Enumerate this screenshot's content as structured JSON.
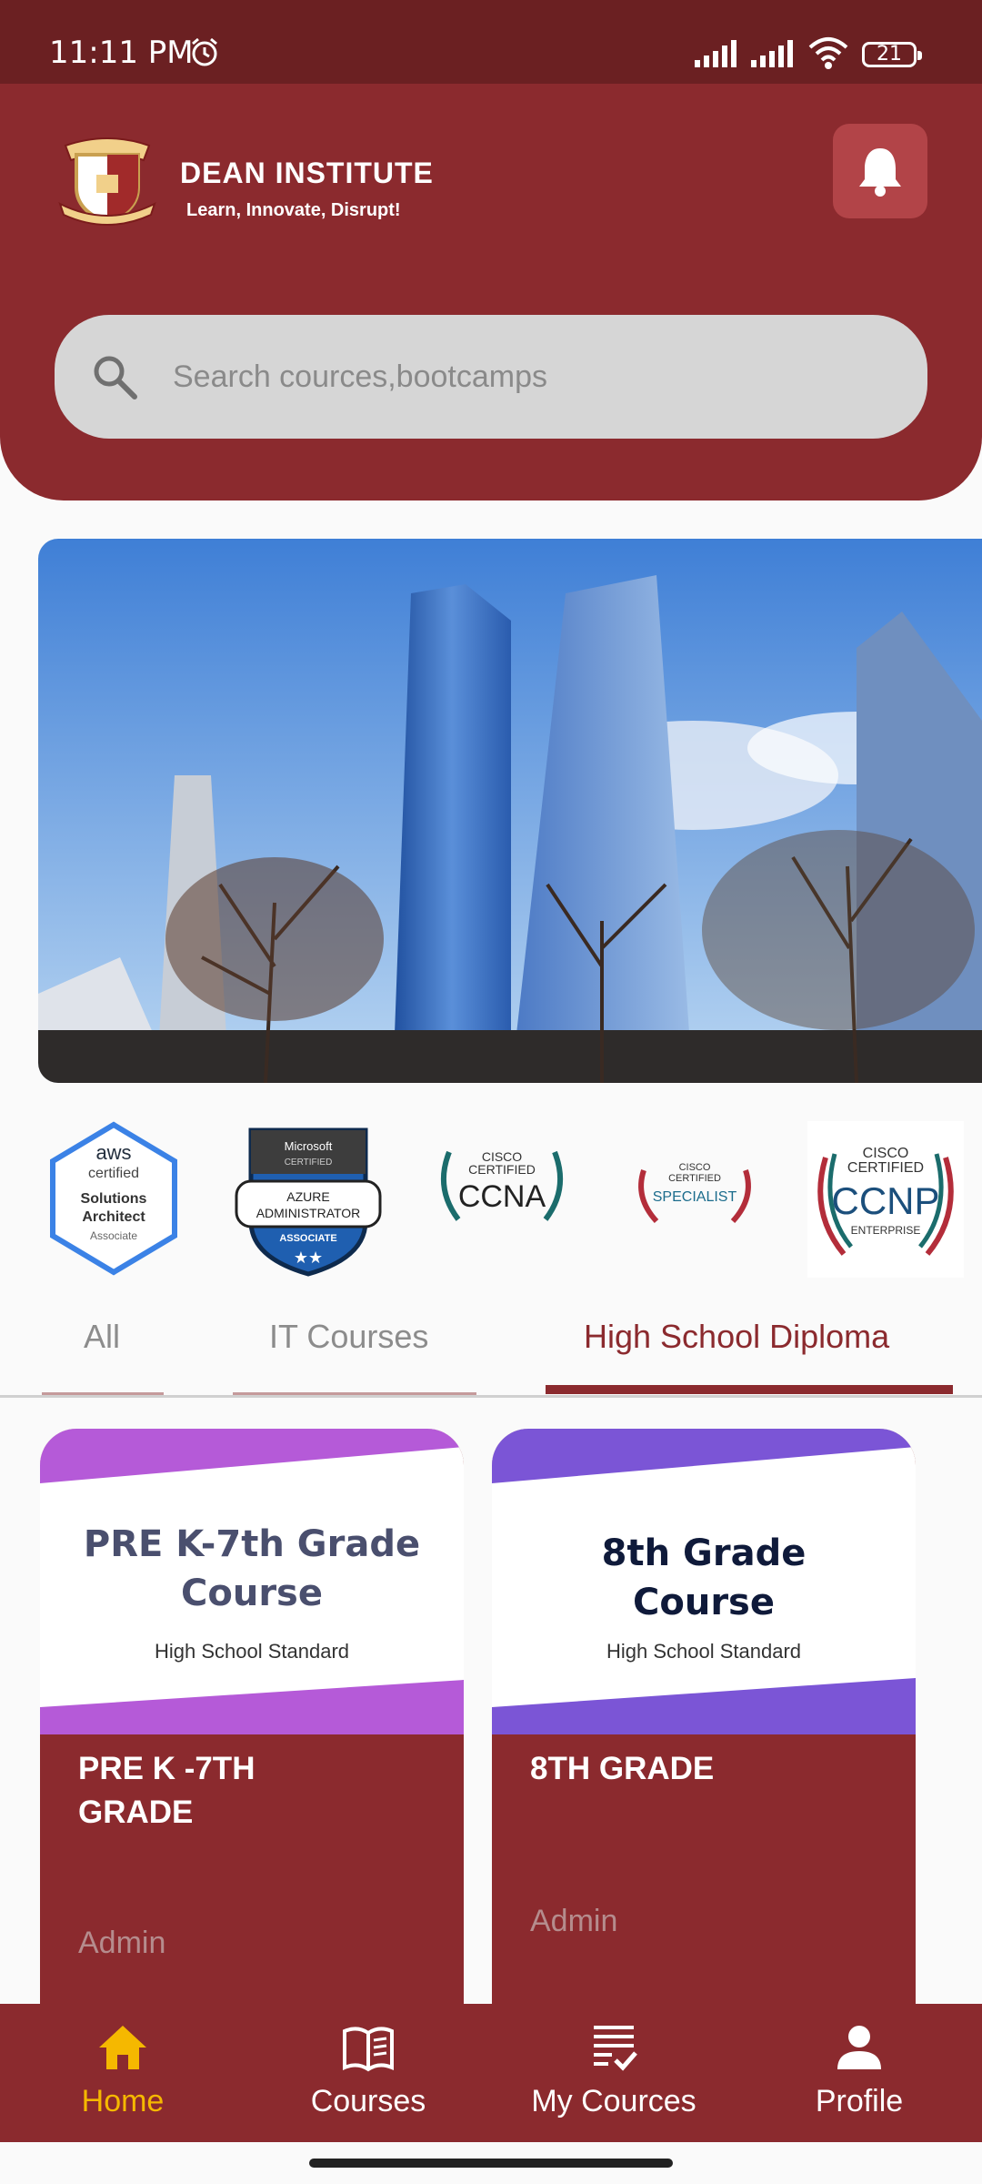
{
  "status": {
    "time": "11:11 PM",
    "battery": "21"
  },
  "header": {
    "brand_title": "DEAN INSTITUTE",
    "brand_subtitle": "Learn, Innovate, Disrupt!",
    "logo_text": "DEAN INSTITUTE"
  },
  "search": {
    "placeholder": "Search cources,bootcamps"
  },
  "certifications": [
    {
      "name": "aws",
      "line1": "aws",
      "line2": "certified",
      "line3": "Solutions",
      "line4": "Architect",
      "line5": "Associate"
    },
    {
      "name": "azure",
      "line1": "Microsoft",
      "line2": "CERTIFIED",
      "line3": "AZURE",
      "line4": "ADMINISTRATOR",
      "line5": "ASSOCIATE"
    },
    {
      "name": "ccna",
      "line1": "CISCO",
      "line2": "CERTIFIED",
      "line3": "CCNA"
    },
    {
      "name": "specialist",
      "line1": "CISCO",
      "line2": "CERTIFIED",
      "line3": "SPECIALIST"
    },
    {
      "name": "ccnp",
      "line1": "CISCO",
      "line2": "CERTIFIED",
      "line3": "CCNP",
      "line4": "ENTERPRISE"
    }
  ],
  "tabs": [
    {
      "label": "All",
      "active": false
    },
    {
      "label": "IT Courses",
      "active": false
    },
    {
      "label": "High School Diploma",
      "active": true
    }
  ],
  "courses": [
    {
      "thumb_title_1": "PRE K-7th Grade",
      "thumb_title_2": "Course",
      "thumb_sub": "High School Standard",
      "title_1": "PRE K -7TH",
      "title_2": "GRADE",
      "author": "Admin",
      "accent": "#b55ad8"
    },
    {
      "thumb_title_1": "8th Grade",
      "thumb_title_2": "Course",
      "thumb_sub": "High School Standard",
      "title_1": "8TH GRADE",
      "title_2": "",
      "author": "Admin",
      "accent": "#7b55d6"
    }
  ],
  "nav": [
    {
      "label": "Home",
      "active": true
    },
    {
      "label": "Courses",
      "active": false
    },
    {
      "label": "My Cources",
      "active": false
    },
    {
      "label": "Profile",
      "active": false
    }
  ],
  "colors": {
    "brand": "#8b2a2e",
    "status_bar": "#6b2022",
    "nav_active": "#f5b800"
  }
}
